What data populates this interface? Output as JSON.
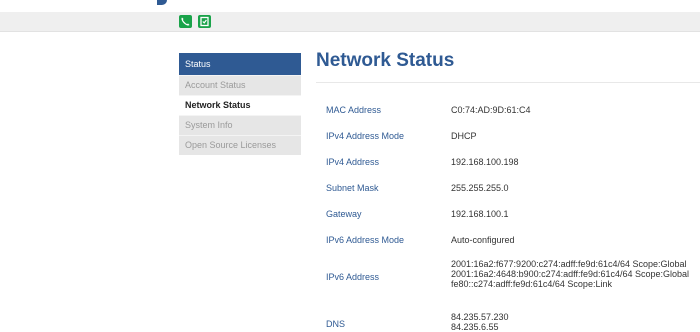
{
  "toolbar": {
    "icons": [
      "phone-icon",
      "screen-share-icon"
    ],
    "accent": "#1aa34a"
  },
  "sidebar": {
    "header": "Status",
    "items": [
      {
        "label": "Account Status",
        "active": false
      },
      {
        "label": "Network Status",
        "active": true
      },
      {
        "label": "System Info",
        "active": false
      },
      {
        "label": "Open Source Licenses",
        "active": false
      }
    ],
    "accent": "#2f5a93"
  },
  "main": {
    "title": "Network Status",
    "rows": [
      {
        "label": "MAC Address",
        "value": "C0:74:AD:9D:61:C4"
      },
      {
        "label": "IPv4 Address Mode",
        "value": "DHCP"
      },
      {
        "label": "IPv4 Address",
        "value": "192.168.100.198"
      },
      {
        "label": "Subnet Mask",
        "value": "255.255.255.0"
      },
      {
        "label": "Gateway",
        "value": "192.168.100.1"
      },
      {
        "label": "IPv6 Address Mode",
        "value": "Auto-configured"
      },
      {
        "label": "IPv6 Address",
        "values": [
          "2001:16a2:f677:9200:c274:adff:fe9d:61c4/64 Scope:Global",
          "2001:16a2:4648:b900:c274:adff:fe9d:61c4/64 Scope:Global",
          "fe80::c274:adff:fe9d:61c4/64 Scope:Link"
        ]
      },
      {
        "label": "DNS",
        "values": [
          "84.235.57.230",
          "84.235.6.55"
        ]
      }
    ]
  }
}
